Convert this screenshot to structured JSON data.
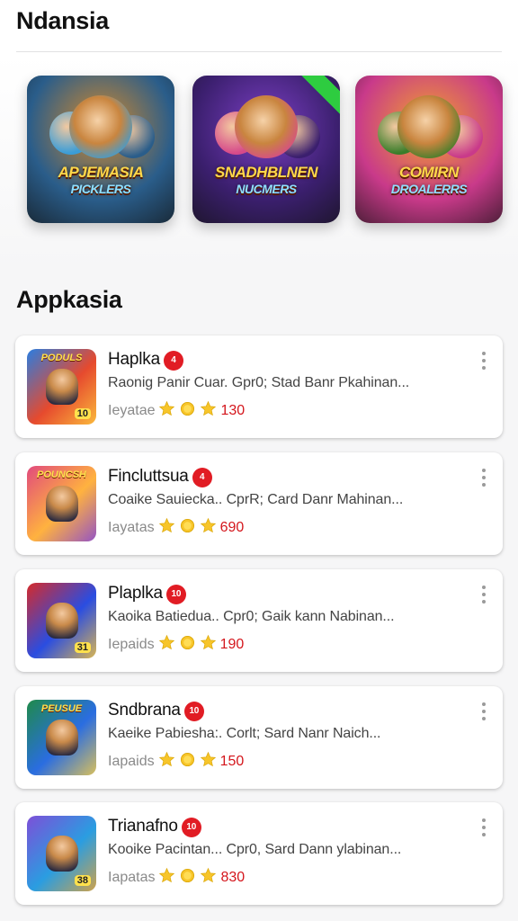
{
  "header": {
    "title": "Ndansia"
  },
  "featured": [
    {
      "label": "APJEMASIA",
      "sub": "PICKLERS",
      "colors": [
        "#2a5d8a",
        "#d68a2a",
        "#3a9dd8"
      ]
    },
    {
      "label": "SNADHBLNEN",
      "sub": "NUCMERS",
      "colors": [
        "#3b1f6e",
        "#7b3fc4",
        "#d64a8a"
      ]
    },
    {
      "label": "COMIRN",
      "sub": "DROALERRS",
      "colors": [
        "#c93a8a",
        "#f2a32a",
        "#3a7d2a"
      ]
    }
  ],
  "section": {
    "title": "Appkasia"
  },
  "apps": [
    {
      "name": "Haplka",
      "badge": "4",
      "desc": "Raonig Panir Cuar. Gpr0; Stad Banr Pkahinan...",
      "meta_label": "Ieyatae",
      "rating": "130",
      "icon_label": "PODULS",
      "icon_num": "10",
      "colors": [
        "#2a7de1",
        "#e64a2e",
        "#ffd23f"
      ]
    },
    {
      "name": "Fincluttsua",
      "badge": "4",
      "desc": "Coaike Sauiecka.. CprR; Card Danr Mahinan...",
      "meta_label": "Iayatas",
      "rating": "690",
      "icon_label": "POUNCSH",
      "icon_num": "",
      "colors": [
        "#e14a7d",
        "#ffb23f",
        "#7d3fe1"
      ]
    },
    {
      "name": "Plaplka",
      "badge": "10",
      "desc": "Kaoika Batiedua.. Cpr0; Gaik kann Nabinan...",
      "meta_label": "Iepaids",
      "rating": "190",
      "icon_label": "",
      "icon_num": "31",
      "colors": [
        "#d62a2a",
        "#2a4de1",
        "#ffcc33"
      ]
    },
    {
      "name": "Sndbrana",
      "badge": "10",
      "desc": "Kaeike Pabiesha:. Corlt; Sard Nanr Naich...",
      "meta_label": "Iapaids",
      "rating": "150",
      "icon_label": "PEUSUE",
      "icon_num": "",
      "colors": [
        "#1f8a4a",
        "#2a6de1",
        "#ffd23f"
      ]
    },
    {
      "name": "Trianafno",
      "badge": "10",
      "desc": "Kooike Pacintan... Cpr0, Sard Dann ylabinan...",
      "meta_label": "Iapatas",
      "rating": "830",
      "icon_label": "",
      "icon_num": "38",
      "colors": [
        "#7d4fd8",
        "#2a9de1",
        "#f2a32a"
      ]
    }
  ]
}
